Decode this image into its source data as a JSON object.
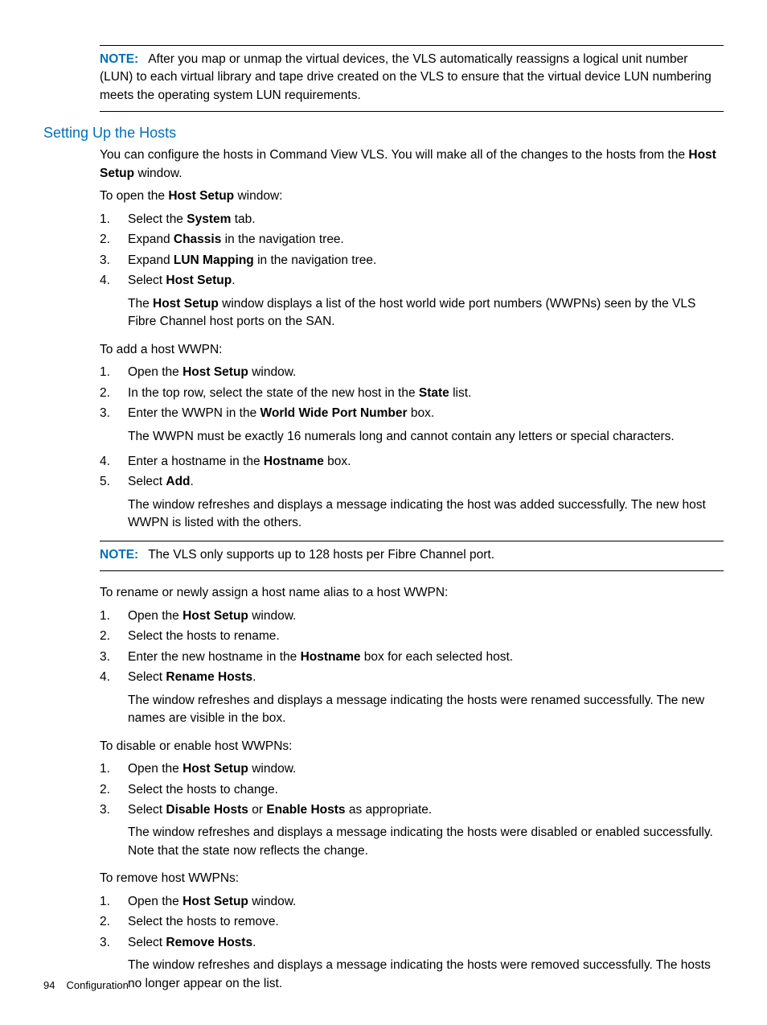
{
  "note1": {
    "label": "NOTE:",
    "text": "After you map or unmap the virtual devices, the VLS automatically reassigns a logical unit number (LUN) to each virtual library and tape drive created on the VLS to ensure that the virtual device LUN numbering meets the operating system LUN requirements."
  },
  "heading": "Setting Up the Hosts",
  "intro": {
    "part1": "You can configure the hosts in Command View VLS. You will make all of the changes to the hosts from the ",
    "bold1": "Host Setup",
    "part2": " window."
  },
  "open_intro": {
    "part1": "To open the ",
    "bold1": "Host Setup",
    "part2": " window:"
  },
  "open_steps": [
    {
      "n": "1.",
      "pre": "Select the ",
      "b": "System",
      "post": " tab."
    },
    {
      "n": "2.",
      "pre": "Expand ",
      "b": "Chassis",
      "post": " in the navigation tree."
    },
    {
      "n": "3.",
      "pre": "Expand ",
      "b": "LUN Mapping",
      "post": " in the navigation tree."
    },
    {
      "n": "4.",
      "pre": "Select ",
      "b": "Host Setup",
      "post": ".",
      "sub_pre": "The ",
      "sub_b": "Host Setup",
      "sub_post": " window displays a list of the host world wide port numbers (WWPNs) seen by the VLS Fibre Channel host ports on the SAN."
    }
  ],
  "add_intro": "To add a host WWPN:",
  "add_steps": [
    {
      "n": "1.",
      "pre": "Open the ",
      "b": "Host Setup",
      "post": " window."
    },
    {
      "n": "2.",
      "pre": "In the top row, select the state of the new host in the ",
      "b": "State",
      "post": " list."
    },
    {
      "n": "3.",
      "pre": "Enter the WWPN in the ",
      "b": "World Wide Port Number",
      "post": " box.",
      "sub": "The WWPN must be exactly 16 numerals long and cannot contain any letters or special characters."
    },
    {
      "n": "4.",
      "pre": "Enter a hostname in the ",
      "b": "Hostname",
      "post": " box."
    },
    {
      "n": "5.",
      "pre": "Select ",
      "b": "Add",
      "post": ".",
      "sub": "The window refreshes and displays a message indicating the host was added successfully. The new host WWPN is listed with the others."
    }
  ],
  "note2": {
    "label": "NOTE:",
    "text": "The VLS only supports up to 128 hosts per Fibre Channel port."
  },
  "rename_intro": "To rename or newly assign a host name alias to a host WWPN:",
  "rename_steps": [
    {
      "n": "1.",
      "pre": "Open the ",
      "b": "Host Setup",
      "post": " window."
    },
    {
      "n": "2.",
      "plain": "Select the hosts to rename."
    },
    {
      "n": "3.",
      "pre": "Enter the new hostname in the ",
      "b": "Hostname",
      "post": " box for each selected host."
    },
    {
      "n": "4.",
      "pre": "Select ",
      "b": "Rename Hosts",
      "post": ".",
      "sub": "The window refreshes and displays a message indicating the hosts were renamed successfully. The new names are visible in the box."
    }
  ],
  "disable_intro": "To disable or enable host WWPNs:",
  "disable_steps": [
    {
      "n": "1.",
      "pre": "Open the ",
      "b": "Host Setup",
      "post": " window."
    },
    {
      "n": "2.",
      "plain": "Select the hosts to change."
    },
    {
      "n": "3.",
      "pre": "Select ",
      "b": "Disable Hosts",
      "mid": " or ",
      "b2": "Enable Hosts",
      "post": " as appropriate.",
      "sub": "The window refreshes and displays a message indicating the hosts were disabled or enabled successfully. Note that the state now reflects the change."
    }
  ],
  "remove_intro": "To remove host WWPNs:",
  "remove_steps": [
    {
      "n": "1.",
      "pre": "Open the ",
      "b": "Host Setup",
      "post": " window."
    },
    {
      "n": "2.",
      "plain": "Select the hosts to remove."
    },
    {
      "n": "3.",
      "pre": "Select ",
      "b": "Remove Hosts",
      "post": ".",
      "sub": "The window refreshes and displays a message indicating the hosts were removed successfully. The hosts no longer appear on the list."
    }
  ],
  "footer": {
    "page": "94",
    "section": "Configuration"
  }
}
